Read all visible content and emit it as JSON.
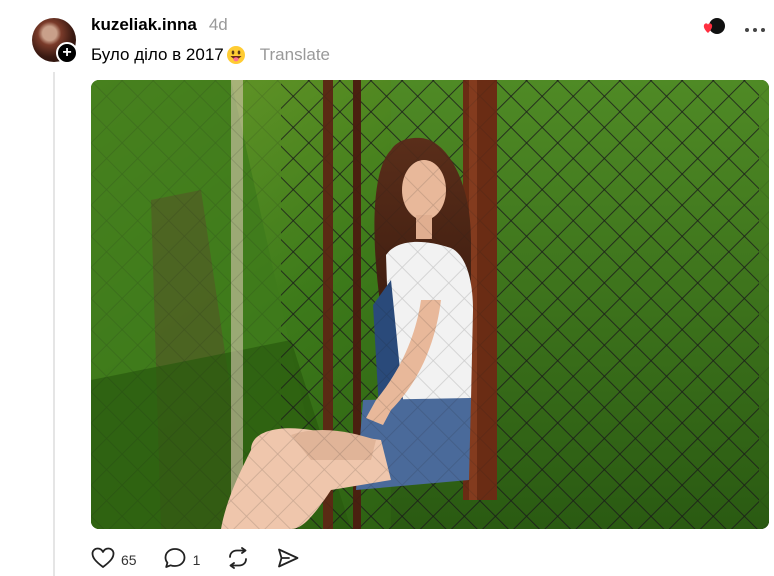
{
  "post": {
    "username": "kuzeliak.inna",
    "timestamp": "4d",
    "caption": "Було діло в 2017",
    "caption_emoji": "grinning-tongue-emoji",
    "translate_label": "Translate"
  },
  "actions": {
    "likes": "65",
    "replies": "1"
  },
  "icons": {
    "avatar": "user-avatar",
    "follow": "plus-icon",
    "reaction": "heart-reaction-icon",
    "more": "more-icon",
    "like": "heart-icon",
    "reply": "comment-icon",
    "repost": "repost-icon",
    "share": "send-icon"
  },
  "colors": {
    "text": "#000000",
    "muted": "#999999",
    "thread_line": "#e5e5e5",
    "reaction_heart": "#ff3040"
  }
}
